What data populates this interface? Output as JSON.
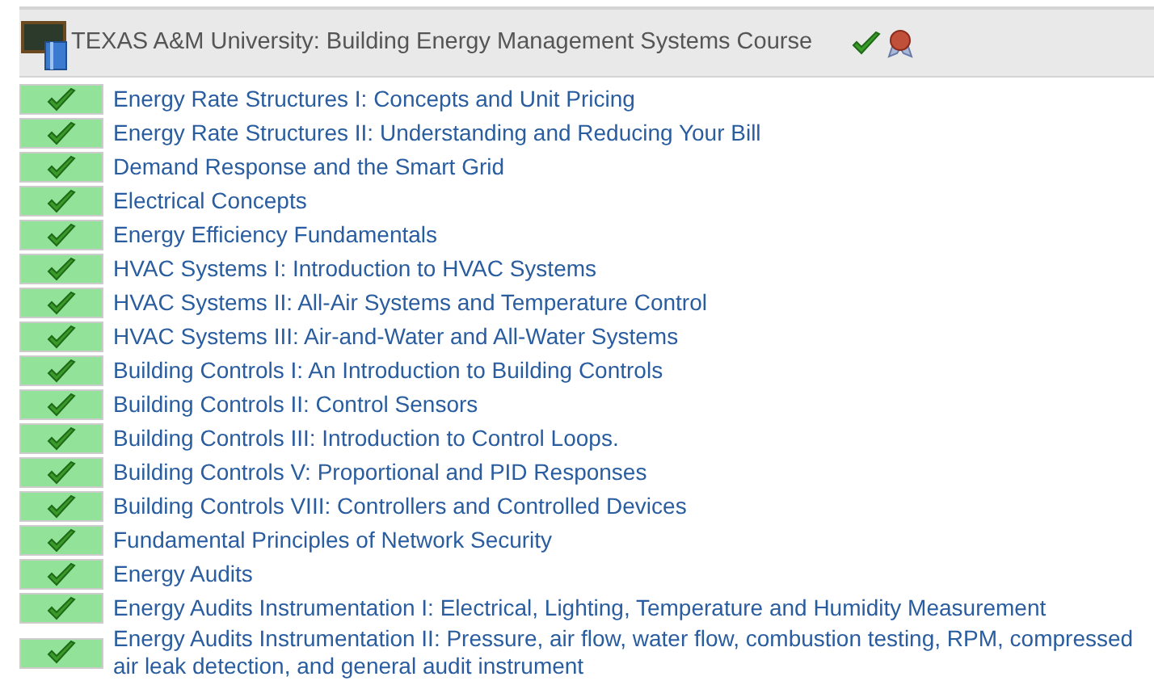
{
  "course": {
    "title": "TEXAS A&M University: Building Energy Management Systems Course",
    "completed": true
  },
  "modules": [
    {
      "title": "Energy Rate Structures I: Concepts and Unit Pricing",
      "completed": true
    },
    {
      "title": "Energy Rate Structures II: Understanding and Reducing Your Bill",
      "completed": true
    },
    {
      "title": "Demand Response and the Smart Grid",
      "completed": true
    },
    {
      "title": "Electrical Concepts",
      "completed": true
    },
    {
      "title": "Energy Efficiency Fundamentals",
      "completed": true
    },
    {
      "title": "HVAC Systems I: Introduction to HVAC Systems",
      "completed": true
    },
    {
      "title": "HVAC Systems II: All-Air Systems and Temperature Control",
      "completed": true
    },
    {
      "title": "HVAC Systems III: Air-and-Water and All-Water Systems",
      "completed": true
    },
    {
      "title": "Building Controls I: An Introduction to Building Controls",
      "completed": true
    },
    {
      "title": "Building Controls II: Control Sensors",
      "completed": true
    },
    {
      "title": "Building Controls III: Introduction to Control Loops.",
      "completed": true
    },
    {
      "title": "Building Controls V: Proportional and PID Responses",
      "completed": true
    },
    {
      "title": "Building Controls VIII: Controllers and Controlled Devices",
      "completed": true
    },
    {
      "title": "Fundamental Principles of Network Security",
      "completed": true
    },
    {
      "title": "Energy Audits",
      "completed": true
    },
    {
      "title": "Energy Audits Instrumentation I: Electrical, Lighting, Temperature and Humidity Measurement",
      "completed": true
    },
    {
      "title": "Energy Audits Instrumentation II: Pressure, air flow, water flow, combustion testing, RPM, compressed air leak detection, and general audit instrument",
      "completed": true
    }
  ]
}
